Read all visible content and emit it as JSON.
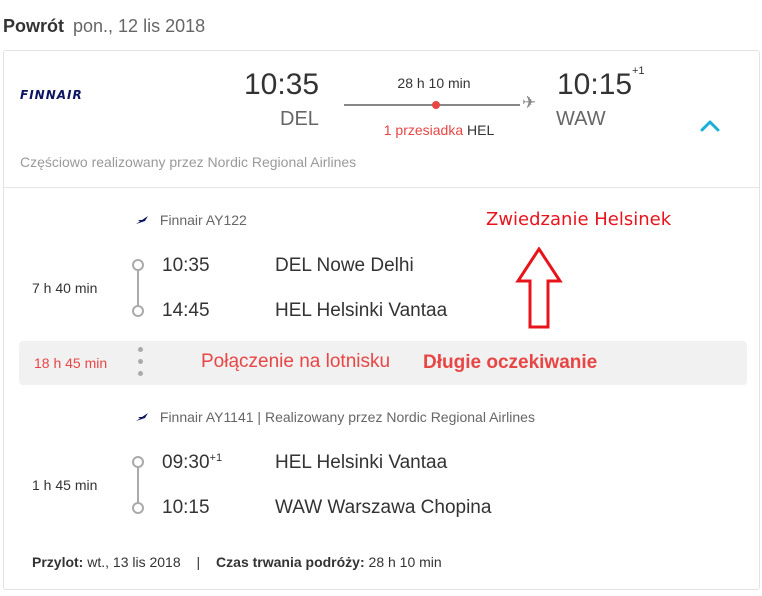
{
  "header": {
    "label": "Powrót",
    "date": "pon., 12 lis 2018"
  },
  "summary": {
    "airline_logo_text": "FINNAIR",
    "dep_time": "10:35",
    "dep_code": "DEL",
    "duration": "28 h 10 min",
    "stops_label": "1 przesiadka",
    "stops_code": "HEL",
    "arr_time": "10:15",
    "arr_day_offset": "+1",
    "arr_code": "WAW",
    "operated_by": "Częściowo realizowany przez Nordic Regional Airlines",
    "colors": {
      "accent": "#e84545",
      "chevron": "#1ab0d8",
      "brand": "#0b1560"
    }
  },
  "segments": [
    {
      "airline": "Finnair AY122",
      "duration": "7 h 40 min",
      "dep_time": "10:35",
      "dep_sup": "",
      "dep_place": "DEL Nowe Delhi",
      "arr_time": "14:45",
      "arr_place": "HEL Helsinki Vantaa"
    },
    {
      "airline": "Finnair AY1141 | Realizowany przez Nordic Regional Airlines",
      "duration": "1 h 45 min",
      "dep_time": "09:30",
      "dep_sup": "+1",
      "dep_place": "HEL Helsinki Vantaa",
      "arr_time": "10:15",
      "arr_place": "WAW Warszawa Chopina"
    }
  ],
  "layover": {
    "duration": "18 h 45 min",
    "text": "Połączenie na lotnisku",
    "warning": "Długie oczekiwanie"
  },
  "annotation": {
    "text": "Zwiedzanie Helsinek",
    "color": "#e8141c"
  },
  "footer": {
    "arrival_label": "Przylot:",
    "arrival_value": "wt., 13 lis 2018",
    "separator": "|",
    "duration_label": "Czas trwania podróży:",
    "duration_value": "28 h 10 min"
  }
}
